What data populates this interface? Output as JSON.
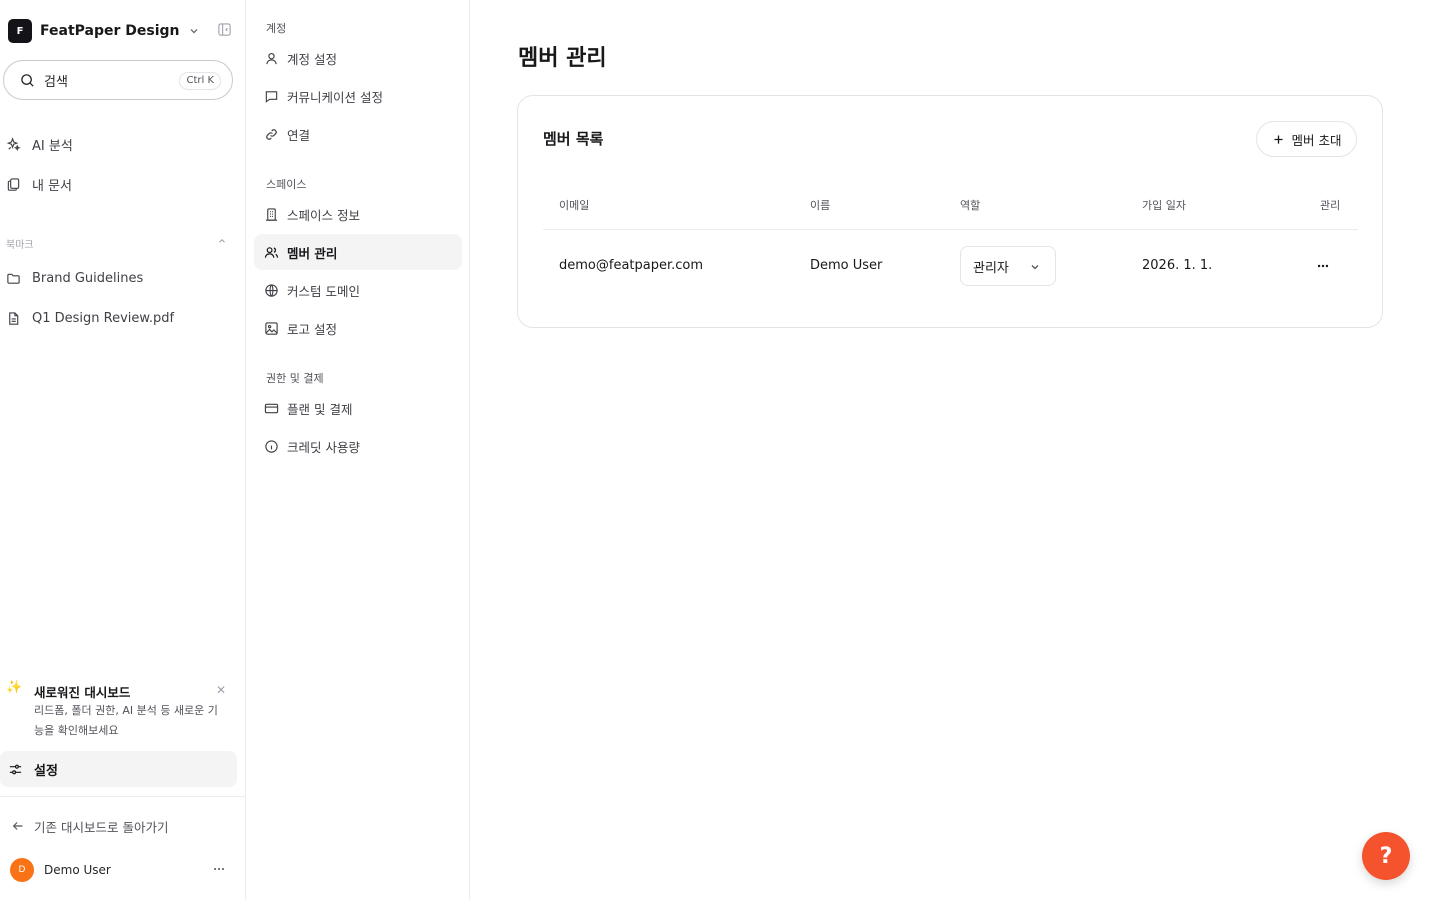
{
  "workspace": {
    "logo_letter": "F",
    "name": "FeatPaper Design"
  },
  "search": {
    "label": "검색",
    "shortcut": "Ctrl K"
  },
  "sidebar": {
    "nav": [
      {
        "label": "AI 분석",
        "icon": "sparkle-icon"
      },
      {
        "label": "내 문서",
        "icon": "documents-icon"
      }
    ],
    "bookmarks_label": "북마크",
    "bookmarks": [
      {
        "label": "Brand Guidelines",
        "icon": "folder-icon"
      },
      {
        "label": "Q1 Design Review.pdf",
        "icon": "file-icon"
      }
    ],
    "promo": {
      "title": "새로워진 대시보드",
      "desc": "리드폼, 폴더 권한, AI 분석 등 새로운 기능을 확인해보세요"
    },
    "settings_label": "설정",
    "back_label": "기존 대시보드로 돌아가기",
    "user": {
      "initial": "D",
      "name": "Demo User"
    }
  },
  "settings_nav": {
    "sections": [
      {
        "title": "계정",
        "items": [
          {
            "label": "계정 설정"
          },
          {
            "label": "커뮤니케이션 설정"
          },
          {
            "label": "연결"
          }
        ]
      },
      {
        "title": "스페이스",
        "items": [
          {
            "label": "스페이스 정보"
          },
          {
            "label": "멤버 관리"
          },
          {
            "label": "커스텀 도메인"
          },
          {
            "label": "로고 설정"
          }
        ]
      },
      {
        "title": "권한 및 결제",
        "items": [
          {
            "label": "플랜 및 결제"
          },
          {
            "label": "크레딧 사용량"
          }
        ]
      }
    ],
    "active": "멤버 관리"
  },
  "main": {
    "title": "멤버 관리",
    "card_title": "멤버 목록",
    "invite_label": "멤버 초대",
    "columns": [
      "이메일",
      "이름",
      "역할",
      "가입 일자",
      "관리"
    ],
    "rows": [
      {
        "email": "demo@featpaper.com",
        "name": "Demo User",
        "role": "관리자",
        "joined": "2026. 1. 1."
      }
    ]
  },
  "help_label": "?",
  "colors": {
    "accent": "#f4532e",
    "avatar": "#f97316",
    "logo_bg": "#141418"
  }
}
